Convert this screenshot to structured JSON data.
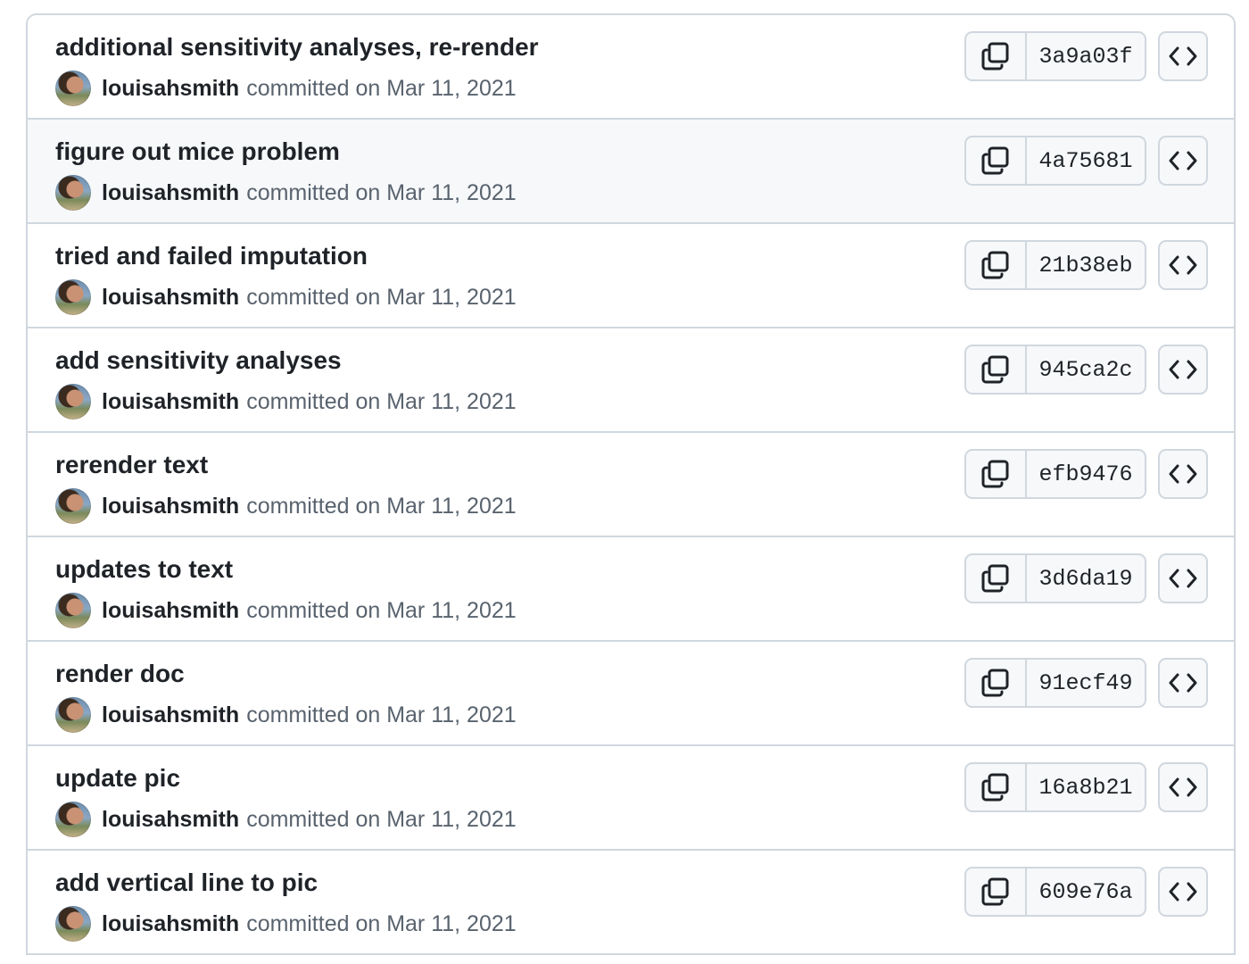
{
  "commits": [
    {
      "title": "additional sensitivity analyses, re-render",
      "author": "louisahsmith",
      "date_text": "committed on Mar 11, 2021",
      "sha": "3a9a03f"
    },
    {
      "title": "figure out mice problem",
      "author": "louisahsmith",
      "date_text": "committed on Mar 11, 2021",
      "sha": "4a75681"
    },
    {
      "title": "tried and failed imputation",
      "author": "louisahsmith",
      "date_text": "committed on Mar 11, 2021",
      "sha": "21b38eb"
    },
    {
      "title": "add sensitivity analyses",
      "author": "louisahsmith",
      "date_text": "committed on Mar 11, 2021",
      "sha": "945ca2c"
    },
    {
      "title": "rerender text",
      "author": "louisahsmith",
      "date_text": "committed on Mar 11, 2021",
      "sha": "efb9476"
    },
    {
      "title": "updates to text",
      "author": "louisahsmith",
      "date_text": "committed on Mar 11, 2021",
      "sha": "3d6da19"
    },
    {
      "title": "render doc",
      "author": "louisahsmith",
      "date_text": "committed on Mar 11, 2021",
      "sha": "91ecf49"
    },
    {
      "title": "update pic",
      "author": "louisahsmith",
      "date_text": "committed on Mar 11, 2021",
      "sha": "16a8b21"
    },
    {
      "title": "add vertical line to pic",
      "author": "louisahsmith",
      "date_text": "committed on Mar 11, 2021",
      "sha": "609e76a"
    }
  ],
  "hovered_row": 1,
  "icons": {
    "copy": "copy-icon",
    "browse": "code-icon"
  },
  "colors": {
    "border": "#d0d7de",
    "hover_background": "#f6f8fa",
    "text_primary": "#1f2328",
    "text_muted": "#59636e"
  }
}
